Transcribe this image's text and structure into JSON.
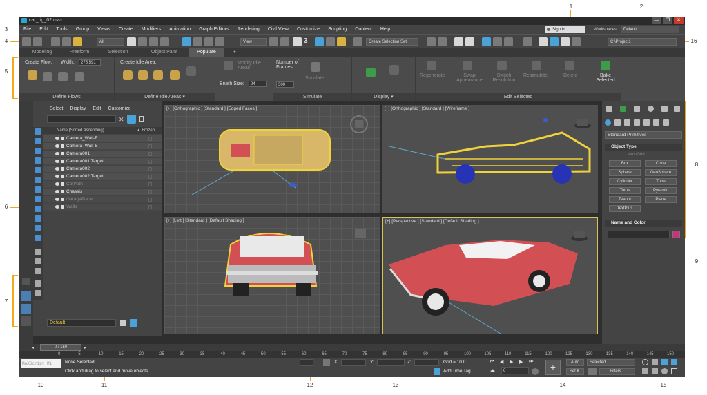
{
  "window": {
    "title": "car_rig_02.max",
    "min": "—",
    "max": "❐",
    "close": "✕"
  },
  "menu": [
    "File",
    "Edit",
    "Tools",
    "Group",
    "Views",
    "Create",
    "Modifiers",
    "Animation",
    "Graph Editors",
    "Rendering",
    "Civil View",
    "Customize",
    "Scripting",
    "Content",
    "Help"
  ],
  "signin": "Sign In",
  "workspace": {
    "label": "Workspaces:",
    "value": "Default"
  },
  "toolbar": {
    "filter_dd": "All",
    "view_dd": "View",
    "selset_dd": "Create Selection Set",
    "project_path": "C:\\Project1",
    "num3": "3"
  },
  "ribbon_tabs": [
    "Modeling",
    "Freeform",
    "Selection",
    "Object Paint",
    "Populate"
  ],
  "ribbon_active": "Populate",
  "ribbon": {
    "create_flow": "Create Flow:",
    "width_label": "Width:",
    "width_value": "275.591",
    "define_flows": "Define Flows",
    "create_idle": "Create Idle Area:",
    "modify_idle": "Modify Idle Areas",
    "brush_label": "Brush Size:",
    "brush_value": "24",
    "define_idle": "Define Idle Areas ▾",
    "num_frames": "Number of Frames:",
    "frames_value": "300",
    "simulate_btn": "Simulate",
    "simulate": "Simulate",
    "display": "Display ▾",
    "regenerate": "Regenerate",
    "swap": "Swap Appearance",
    "switch_res": "Switch Resolution",
    "resimulate": "Resimulate",
    "delete": "Delete",
    "bake": "Bake Selected",
    "edit_selected": "Edit Selected"
  },
  "scene": {
    "menu": [
      "Select",
      "Display",
      "Edit",
      "Customize"
    ],
    "col_name": "Name (Sorted Ascending)",
    "col_frozen": "▲ Frozen",
    "rows": [
      {
        "name": "Camera_Wall-E",
        "dim": false
      },
      {
        "name": "Camera_Wall-S",
        "dim": false
      },
      {
        "name": "Camera001",
        "dim": false
      },
      {
        "name": "Camera001.Target",
        "dim": false
      },
      {
        "name": "Camera002",
        "dim": false
      },
      {
        "name": "Camera002.Target",
        "dim": false
      },
      {
        "name": "CarPath",
        "dim": true
      },
      {
        "name": "Chassis",
        "dim": false
      },
      {
        "name": "GaragePlace",
        "dim": true
      },
      {
        "name": "Walls",
        "dim": true
      }
    ],
    "layer": "Default"
  },
  "viewports": {
    "top": "[+] [Orthographic ] [Standard ] [Edged Faces ]",
    "front": "[+] [Orthographic ] [Standard ] [Wireframe ]",
    "left": "[+] [Left ] [Standard ] [Default Shading ]",
    "persp": "[+] [Perspective ] [Standard ] [Default Shading ]"
  },
  "command_panel": {
    "dropdown": "Standard Primitives",
    "object_type": "Object Type",
    "autogrid": "AutoGrid",
    "objects": [
      "Box",
      "Cone",
      "Sphere",
      "GeoSphere",
      "Cylinder",
      "Tube",
      "Torus",
      "Pyramid",
      "Teapot",
      "Plane",
      "TextPlus"
    ],
    "name_color": "Name and Color"
  },
  "timeline": {
    "slider": "0 / 150",
    "ticks": [
      "0",
      "5",
      "10",
      "15",
      "20",
      "25",
      "30",
      "35",
      "40",
      "45",
      "50",
      "55",
      "60",
      "65",
      "70",
      "75",
      "80",
      "85",
      "90",
      "95",
      "100",
      "105",
      "110",
      "115",
      "120",
      "125",
      "130",
      "135",
      "140",
      "145",
      "150"
    ]
  },
  "status": {
    "maxscript": "MAXScript Mi",
    "selected": "None Selected",
    "prompt": "Click and drag to select and move objects",
    "x": "X:",
    "y": "Y:",
    "z": "Z:",
    "grid": "Grid = 10.0",
    "add_time_tag": "Add Time Tag",
    "frame_value": "0",
    "auto": "Auto",
    "selected_dd": "Selected",
    "setk": "Set K.",
    "filters": "Filters..."
  },
  "callouts": [
    "1",
    "2",
    "3",
    "4",
    "5",
    "6",
    "7",
    "8",
    "9",
    "10",
    "11",
    "12",
    "13",
    "14",
    "15",
    "16"
  ],
  "colors": {
    "accent": "#f2a91f",
    "car_body": "#d24f54",
    "wire": "#f0d23a",
    "blue_ui": "#4aa3d8"
  }
}
